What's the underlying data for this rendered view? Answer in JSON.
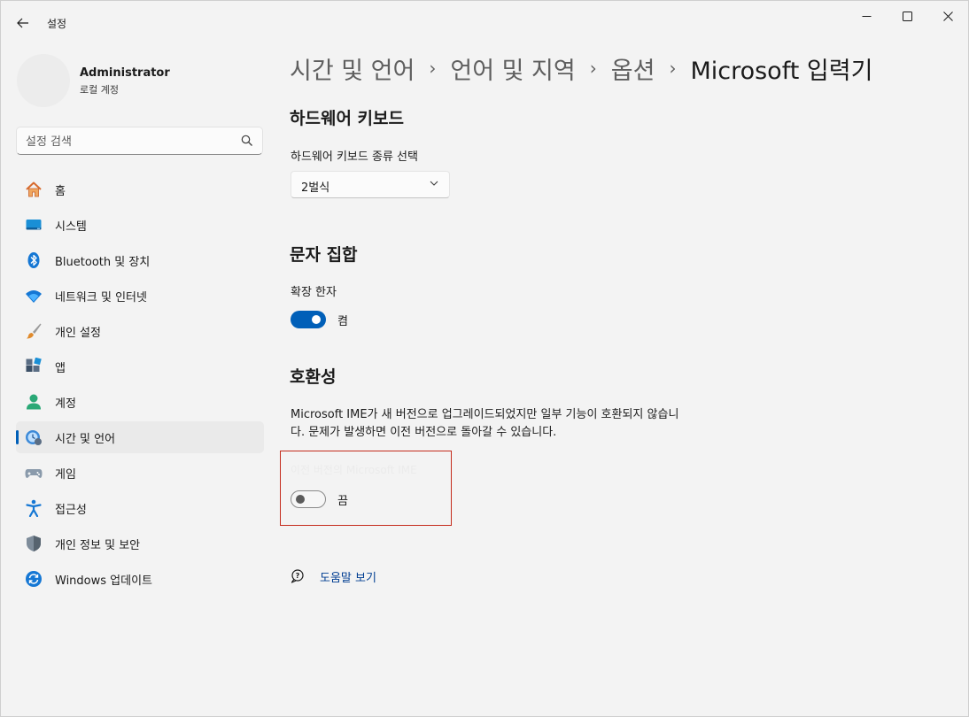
{
  "titlebar": {
    "app_title": "설정"
  },
  "profile": {
    "name": "Administrator",
    "account_type": "로컬 계정"
  },
  "search": {
    "placeholder": "설정 검색"
  },
  "nav": {
    "items": [
      {
        "label": "홈",
        "icon": "home-icon"
      },
      {
        "label": "시스템",
        "icon": "system-icon"
      },
      {
        "label": "Bluetooth 및 장치",
        "icon": "bluetooth-icon"
      },
      {
        "label": "네트워크 및 인터넷",
        "icon": "wifi-icon"
      },
      {
        "label": "개인 설정",
        "icon": "brush-icon"
      },
      {
        "label": "앱",
        "icon": "apps-icon"
      },
      {
        "label": "계정",
        "icon": "account-icon"
      },
      {
        "label": "시간 및 언어",
        "icon": "time-language-icon",
        "active": true
      },
      {
        "label": "게임",
        "icon": "gamepad-icon"
      },
      {
        "label": "접근성",
        "icon": "accessibility-icon"
      },
      {
        "label": "개인 정보 및 보안",
        "icon": "shield-icon"
      },
      {
        "label": "Windows 업데이트",
        "icon": "update-icon"
      }
    ]
  },
  "breadcrumb": {
    "items": [
      "시간 및 언어",
      "언어 및 지역",
      "옵션",
      "Microsoft 입력기"
    ],
    "separator": "›"
  },
  "hardware_keyboard": {
    "title": "하드웨어 키보드",
    "select_label": "하드웨어 키보드 종류 선택",
    "selected_value": "2벌식"
  },
  "charset": {
    "title": "문자 집합",
    "option_label": "확장 한자",
    "toggle_state": "켬",
    "enabled": true
  },
  "compatibility": {
    "title": "호환성",
    "description": "Microsoft IME가 새 버전으로 업그레이드되었지만 일부 기능이 호환되지 않습니다. 문제가 발생하면 이전 버전으로 돌아갈 수 있습니다.",
    "option_label": "이전 버전의 Microsoft IME",
    "toggle_state": "끔",
    "enabled": false
  },
  "help": {
    "link_text": "도움말 보기"
  },
  "colors": {
    "accent": "#005fb8",
    "highlight_border": "#c42b1c",
    "link": "#003e92",
    "background": "#f3f3f3"
  }
}
